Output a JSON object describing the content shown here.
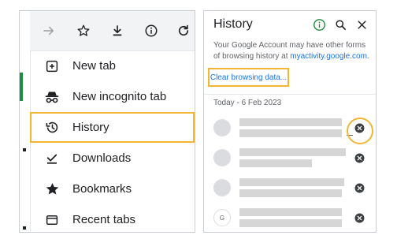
{
  "chrome_menu": {
    "toolbar_icons": [
      "forward-arrow-icon",
      "star-icon",
      "download-icon",
      "info-icon",
      "reload-icon"
    ],
    "items": [
      {
        "label": "New tab",
        "icon": "new-tab-icon"
      },
      {
        "label": "New incognito tab",
        "icon": "incognito-icon"
      },
      {
        "label": "History",
        "icon": "history-icon",
        "highlighted": true
      },
      {
        "label": "Downloads",
        "icon": "download-done-icon"
      },
      {
        "label": "Bookmarks",
        "icon": "star-filled-icon"
      },
      {
        "label": "Recent tabs",
        "icon": "recent-tabs-icon"
      }
    ]
  },
  "history_panel": {
    "title": "History",
    "header_icons": [
      "info-icon",
      "search-icon",
      "close-icon"
    ],
    "note_text": "Your Google Account may have other forms of browsing history at",
    "note_link": "myactivity.google.com.",
    "clear_button": "Clear browsing data...",
    "date_header": "Today - 6 Feb 2023",
    "avatar_g": "G"
  },
  "colors": {
    "highlight": "#f2b632",
    "link": "#1a73e8",
    "green_tab": "#1e8e3e"
  }
}
